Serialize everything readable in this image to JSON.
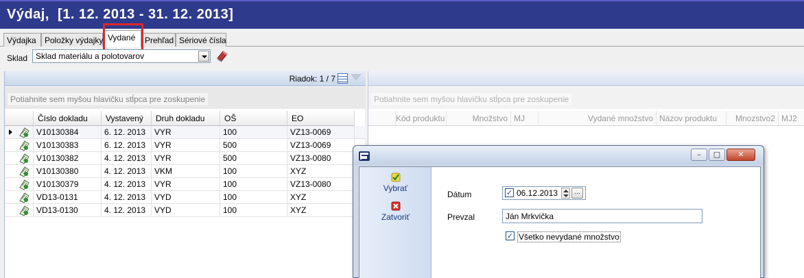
{
  "window": {
    "title": "Výdaj,  [1. 12. 2013 - 31. 12. 2013]"
  },
  "tabs": [
    "Výdajka",
    "Položky výdajky",
    "Vydané",
    "Prehľad",
    "Sériové čísla"
  ],
  "active_tab": "Vydané",
  "toolbar": {
    "sklad_label": "Sklad",
    "sklad_value": "Sklad materiálu a polotovarov"
  },
  "left_grid": {
    "row_count": "Riadok: 1 / 7",
    "group_hint": "Potiahnite sem myšou hlavičku stĺpca pre zoskupenie",
    "columns": [
      "Číslo dokladu",
      "Vystavený",
      "Druh dokladu",
      "OŠ",
      "EO"
    ],
    "rows": [
      [
        "V10130384",
        "6. 12. 2013",
        "VYR",
        "100",
        "VZ13-0069"
      ],
      [
        "V10130383",
        "6. 12. 2013",
        "VYR",
        "500",
        "VZ13-0069"
      ],
      [
        "V10130382",
        "4. 12. 2013",
        "VYR",
        "500",
        "VZ13-0080"
      ],
      [
        "V10130380",
        "4. 12. 2013",
        "VKM",
        "100",
        "XYZ"
      ],
      [
        "V10130379",
        "4. 12. 2013",
        "VYR",
        "100",
        "VZ13-0080"
      ],
      [
        "VD13-0131",
        "4. 12. 2013",
        "VYD",
        "100",
        "XYZ"
      ],
      [
        "VD13-0130",
        "4. 12. 2013",
        "VYD",
        "100",
        "XYZ"
      ]
    ]
  },
  "right_grid": {
    "group_hint": "Potiahnite sem myšou hlavičku stĺpca pre zoskupenie",
    "columns": [
      "Kód produktu",
      "Množstvo",
      "MJ",
      "Vydané množstvo",
      "Názov produktu",
      "Mnozstvo2",
      "MJ2"
    ]
  },
  "dialog": {
    "side_items": [
      "Vybrať",
      "Zatvoriť"
    ],
    "datum_label": "Dátum",
    "datum_value": "06.12.2013",
    "ellipsis": "...",
    "prevzal_label": "Prevzal",
    "prevzal_value": "Ján Mrkvička",
    "checkbox_label": "Všetko nevydané množstvo"
  },
  "colors": {
    "title_bar": "#2e3a8c",
    "highlight": "#e0262b"
  }
}
